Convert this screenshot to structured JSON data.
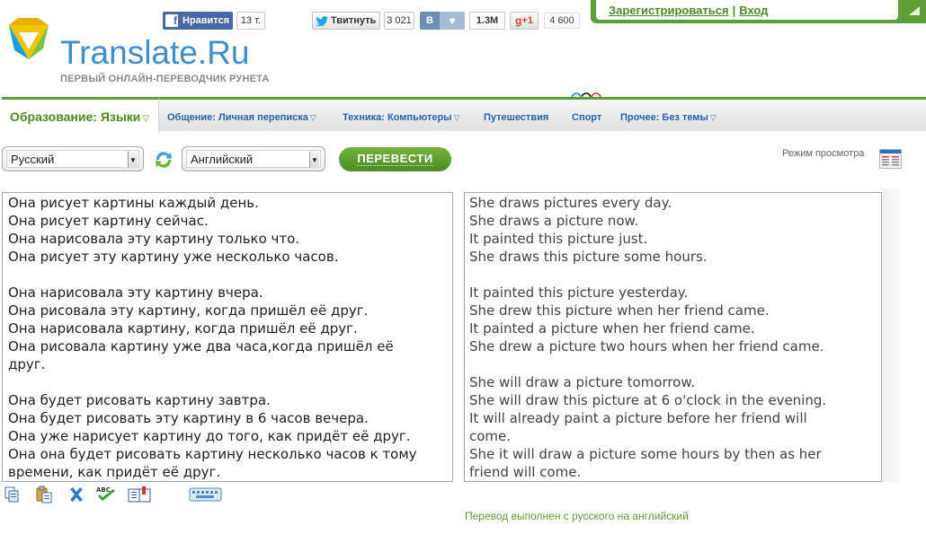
{
  "brand": {
    "name": "Translate.Ru",
    "slogan": "ПЕРВЫЙ ОНЛАЙН-ПЕРЕВОДЧИК РУНЕТА"
  },
  "social": {
    "facebook": {
      "label": "Нравится",
      "count": "13 т."
    },
    "twitter": {
      "label": "Твитнуть",
      "count": "3 021"
    },
    "vk": {
      "label": "В",
      "count": "1.3M"
    },
    "gplus": {
      "label": "+1",
      "count": "4 600"
    }
  },
  "account": {
    "register": "Зарегистрироваться",
    "separator": "|",
    "login": "Вход"
  },
  "topics": {
    "active": "Образование: Языки",
    "items": [
      {
        "label": "Общение: Личная переписка",
        "has_menu": true
      },
      {
        "label": "Техника: Компьютеры",
        "has_menu": true
      },
      {
        "label": "Путешествия",
        "has_menu": false
      },
      {
        "label": "Спорт",
        "has_menu": false
      },
      {
        "label": "Прочее: Без темы",
        "has_menu": true
      }
    ]
  },
  "controls": {
    "from_language": "Русский",
    "to_language": "Английский",
    "translate_button": "ПЕРЕВЕСТИ",
    "view_mode": "Режим просмотра"
  },
  "source_lines": [
    "Она рисует картины каждый день.",
    "Она рисует картину сейчас.",
    "Она нарисовала эту картину только что.",
    "Она рисует эту картину уже несколько часов.",
    "",
    "Она нарисовала эту картину вчера.",
    "Она рисовала эту картину, когда пришёл её друг.",
    "Она нарисовала картину, когда пришёл её друг.",
    "Она рисовала картину уже два часа,когда пришёл её",
    "друг.",
    "",
    "Она будет рисовать картину завтра.",
    "Она будет рисовать эту картину в 6 часов вечера.",
    "Она уже нарисует картину до того, как придёт её друг.",
    "Она она будет рисовать картину несколько часов к тому",
    "времени, как придёт её друг."
  ],
  "target_lines": [
    "She draws pictures every day.",
    "She draws a picture now.",
    "It painted this picture just.",
    "She draws this picture some hours.",
    "",
    "It painted this picture yesterday.",
    "She drew this picture when her friend came.",
    "It painted a picture when her friend came.",
    "She drew a picture two hours when her friend came.",
    "",
    "She will draw a picture tomorrow.",
    "She will draw this picture at 6 o'clock in the evening.",
    "It will already paint a picture before her friend will",
    "come.",
    "She it will draw a picture some hours by then as her",
    "friend will come."
  ],
  "status_text": "Перевод выполнен с русского на английский",
  "icons": [
    "copy-icon",
    "paste-icon",
    "clear-icon",
    "spellcheck-icon",
    "dictionary-icon",
    "keyboard-icon",
    "swap-icon",
    "view-mode-icon",
    "olympic-rings-icon",
    "logo-icon"
  ],
  "colors": {
    "accent_green": "#5f9e34",
    "link_blue": "#2a62a6",
    "brand_blue": "#3d8ed3"
  }
}
